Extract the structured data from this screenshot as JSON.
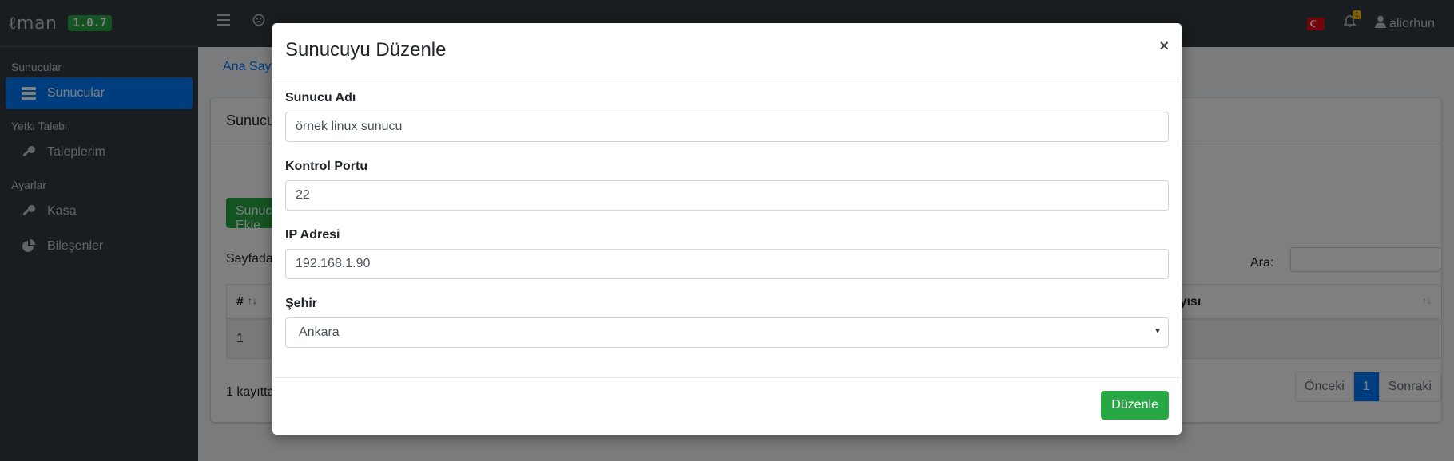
{
  "app": {
    "logo_text": "man",
    "version": "1.0.7"
  },
  "sidebar": {
    "sections": [
      {
        "header": "Sunucular",
        "items": [
          {
            "label": "Sunucular",
            "icon": "server-icon",
            "active": true
          }
        ]
      },
      {
        "header": "Yetki Talebi",
        "items": [
          {
            "label": "Taleplerim",
            "icon": "key-icon"
          }
        ]
      },
      {
        "header": "Ayarlar",
        "items": [
          {
            "label": "Kasa",
            "icon": "key-icon"
          },
          {
            "label": "Bileşenler",
            "icon": "pie-chart-icon"
          }
        ]
      }
    ]
  },
  "topnav": {
    "notification_count": "1",
    "username": "aliorhun",
    "language": "tr"
  },
  "page": {
    "breadcrumb": "Ana Sayfa",
    "card_title": "Sunucular",
    "add_button": "Sunucu Ekle",
    "page_size_label": "Sayfada",
    "search_label": "Ara:",
    "table": {
      "col_hash": "#",
      "col_last": "Sayısı",
      "row_first": "1"
    },
    "info": "1 kayıttan",
    "pagination": {
      "prev": "Önceki",
      "current": "1",
      "next": "Sonraki"
    }
  },
  "modal": {
    "title": "Sunucuyu Düzenle",
    "close": "×",
    "fields": {
      "name": {
        "label": "Sunucu Adı",
        "value": "örnek linux sunucu"
      },
      "port": {
        "label": "Kontrol Portu",
        "value": "22"
      },
      "ip": {
        "label": "IP Adresi",
        "value": "192.168.1.90"
      },
      "city": {
        "label": "Şehir",
        "value": "Ankara"
      }
    },
    "submit": "Düzenle"
  },
  "colors": {
    "primary": "#007bff",
    "success": "#28a745",
    "sidebar": "#343a40",
    "warning": "#ffc107"
  }
}
